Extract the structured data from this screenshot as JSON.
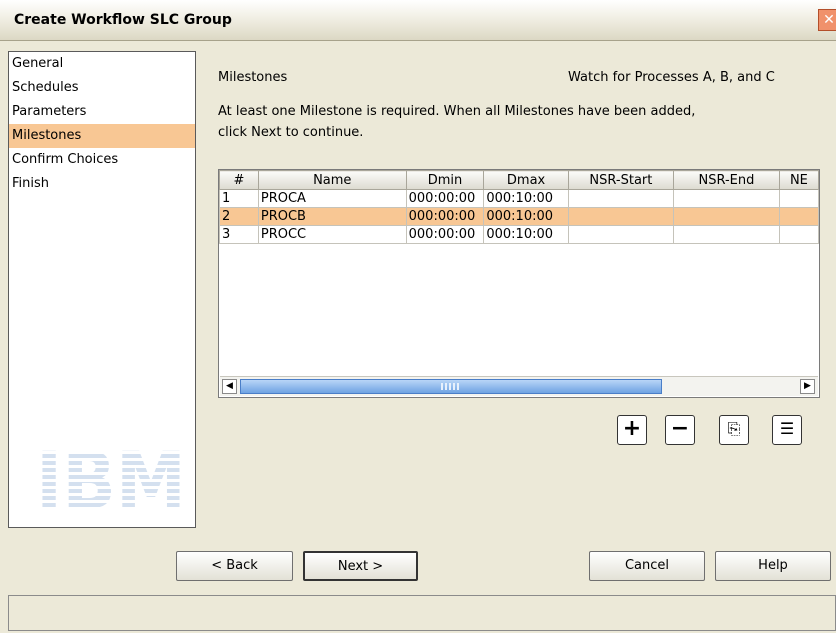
{
  "window": {
    "title": "Create Workflow SLC Group",
    "close_glyph": "✕"
  },
  "nav": {
    "items": [
      {
        "label": "General",
        "selected": false
      },
      {
        "label": "Schedules",
        "selected": false
      },
      {
        "label": "Parameters",
        "selected": false
      },
      {
        "label": "Milestones",
        "selected": true
      },
      {
        "label": "Confirm Choices",
        "selected": false
      },
      {
        "label": "Finish",
        "selected": false
      }
    ]
  },
  "logo": {
    "text": "IBM"
  },
  "panel": {
    "title": "Milestones",
    "watch_text": "Watch for Processes A, B, and C",
    "instruction_line1": "At least one Milestone is required. When all Milestones have been added,",
    "instruction_line2": "click Next to continue."
  },
  "table": {
    "columns": [
      "#",
      "Name",
      "Dmin",
      "Dmax",
      "NSR-Start",
      "NSR-End",
      "NE"
    ],
    "rows": [
      {
        "cells": [
          "1",
          "PROCA",
          "000:00:00",
          "000:10:00",
          "",
          "",
          ""
        ],
        "selected": false
      },
      {
        "cells": [
          "2",
          "PROCB",
          "000:00:00",
          "000:10:00",
          "",
          "",
          ""
        ],
        "selected": true
      },
      {
        "cells": [
          "3",
          "PROCC",
          "000:00:00",
          "000:10:00",
          "",
          "",
          ""
        ],
        "selected": false
      }
    ],
    "scroll_left_glyph": "◀",
    "scroll_right_glyph": "▶"
  },
  "table_actions": [
    {
      "name": "add-button",
      "glyph": "+",
      "icon": "plus-icon"
    },
    {
      "name": "remove-button",
      "glyph": "−",
      "icon": "minus-icon"
    },
    {
      "name": "copy-button",
      "glyph": "⎘",
      "icon": "copy-icon"
    },
    {
      "name": "properties-button",
      "glyph": "☰",
      "icon": "properties-icon"
    }
  ],
  "buttons": {
    "back": "< Back",
    "next": "Next >",
    "cancel": "Cancel",
    "help": "Help"
  },
  "status": {
    "text": ""
  },
  "colors": {
    "selection": "#f8c794",
    "background": "#ece9d8",
    "scroll_thumb": "#6fa3e3"
  }
}
